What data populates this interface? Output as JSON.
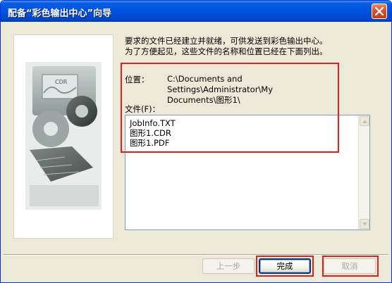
{
  "window": {
    "title": "配备“彩色输出中心”向导"
  },
  "intro": {
    "line1": "要求的文件已经建立并就绪，可供发送到彩色输出中心。",
    "line2": "为了方便起见，这些文件的名称和位置已经在下面列出。"
  },
  "location": {
    "label": "位置：",
    "value_line1": "C:\\Documents and Settings\\Administrator\\My",
    "value_line2": "Documents\\图形1\\"
  },
  "files": {
    "label": "文件(F)：",
    "items": [
      "JobInfo.TXT",
      "图形1.CDR",
      "图形1.PDF"
    ]
  },
  "buttons": {
    "back": "上一步",
    "finish": "完成",
    "cancel": "取消"
  },
  "banner": {
    "badge": "CDR"
  },
  "icons": {
    "close": "close-icon",
    "scroll_up": "chevron-up-icon",
    "scroll_down": "chevron-down-icon"
  },
  "colors": {
    "titlebar": "#0054e3",
    "highlight": "#e0201d",
    "dialog_bg": "#ece9d8"
  }
}
